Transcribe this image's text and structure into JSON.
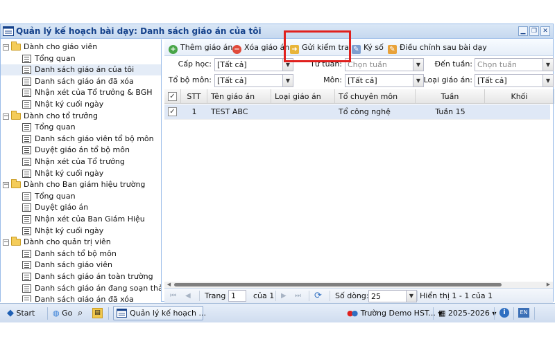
{
  "window": {
    "title": "Quản lý kế hoạch bài dạy: Danh sách giáo án của tôi",
    "controls": [
      "minimize-icon",
      "restore-icon",
      "close-icon"
    ]
  },
  "sidebar": {
    "groups": [
      {
        "label": "Dành cho giáo viên",
        "items": [
          {
            "label": "Tổng quan"
          },
          {
            "label": "Danh sách giáo án của tôi",
            "selected": true
          },
          {
            "label": "Danh sách giáo án đã xóa"
          },
          {
            "label": "Nhận xét của Tổ trưởng & BGH"
          },
          {
            "label": "Nhật ký cuối ngày"
          }
        ]
      },
      {
        "label": "Dành cho tổ trưởng",
        "items": [
          {
            "label": "Tổng quan"
          },
          {
            "label": "Danh sách giáo viên tổ bộ môn"
          },
          {
            "label": "Duyệt giáo án tổ bộ môn"
          },
          {
            "label": "Nhận xét của Tổ trưởng"
          },
          {
            "label": "Nhật ký cuối ngày"
          }
        ]
      },
      {
        "label": "Dành cho Ban giám hiệu trường",
        "items": [
          {
            "label": "Tổng quan"
          },
          {
            "label": "Duyệt giáo án"
          },
          {
            "label": "Nhận xét của Ban Giám Hiệu"
          },
          {
            "label": "Nhật ký cuối ngày"
          }
        ]
      },
      {
        "label": "Dành cho quản trị viên",
        "items": [
          {
            "label": "Danh sách tổ bộ môn"
          },
          {
            "label": "Danh sách giáo viên"
          },
          {
            "label": "Danh sách giáo án toàn trường"
          },
          {
            "label": "Danh sách giáo án đang soạn thảo"
          },
          {
            "label": "Danh sách giáo án đã xóa"
          }
        ]
      }
    ]
  },
  "toolbar": {
    "add_label": "Thêm giáo án",
    "delete_label": "Xóa giáo án",
    "send_label": "Gửi kiểm tra",
    "sign_label": "Ký số",
    "adjust_label": "Điều chỉnh sau bài dạy"
  },
  "filters": {
    "cap_hoc_label": "Cấp học:",
    "cap_hoc_value": "[Tất cả]",
    "tu_tuan_label": "Từ tuần:",
    "tu_tuan_placeholder": "Chọn tuần",
    "den_tuan_label": "Đến tuần:",
    "den_tuan_placeholder": "Chọn tuần",
    "to_bo_mon_label": "Tổ bộ môn:",
    "to_bo_mon_value": "[Tất cả]",
    "mon_label": "Môn:",
    "mon_value": "[Tất cả]",
    "loai_label": "Loại giáo án:",
    "loai_value": "[Tất cả]"
  },
  "grid": {
    "columns": [
      "STT",
      "Tên giáo án",
      "Loại giáo án",
      "Tổ chuyên môn",
      "Tuần",
      "Khối"
    ],
    "rows": [
      {
        "stt": "1",
        "ten": "TEST ABC",
        "loai": "",
        "to": "Tổ công nghệ",
        "tuan": "Tuần 15",
        "khoi": "",
        "checked": true
      }
    ]
  },
  "pager": {
    "page_label": "Trang",
    "page_value": "1",
    "of_label": "của 1",
    "rows_label": "Số dòng:",
    "rows_value": "25",
    "display_text": "Hiển thị 1 - 1 của 1"
  },
  "taskbar": {
    "start_label": "Start",
    "go_label": "Go",
    "window_label": "Quản lý kế hoạch ...",
    "school_label": "Trường Demo HST...",
    "year_label": "2025-2026",
    "lang_label": "EN"
  },
  "annotation": {
    "color": "#e0201d"
  }
}
